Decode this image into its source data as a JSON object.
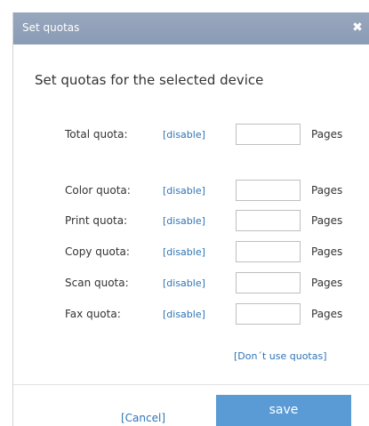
{
  "dialog": {
    "title": "Set quotas",
    "close_glyph": "✖",
    "close_icon": "close-icon",
    "heading": "Set quotas for the selected device"
  },
  "quotas": [
    {
      "label": "Total quota:",
      "disable": "[disable]",
      "value": "",
      "unit": "Pages"
    },
    {
      "label": "Color quota:",
      "disable": "[disable]",
      "value": "",
      "unit": "Pages"
    },
    {
      "label": "Print quota:",
      "disable": "[disable]",
      "value": "",
      "unit": "Pages"
    },
    {
      "label": "Copy quota:",
      "disable": "[disable]",
      "value": "",
      "unit": "Pages"
    },
    {
      "label": "Scan quota:",
      "disable": "[disable]",
      "value": "",
      "unit": "Pages"
    },
    {
      "label": "Fax quota:",
      "disable": "[disable]",
      "value": "",
      "unit": "Pages"
    }
  ],
  "no_quotas_link": "[Don´t use quotas]",
  "footer": {
    "cancel_label": "[Cancel]",
    "save_label": "save"
  },
  "colors": {
    "titlebar": "#8a9bb5",
    "link": "#2f74b5",
    "save_button": "#5b9bd5"
  }
}
